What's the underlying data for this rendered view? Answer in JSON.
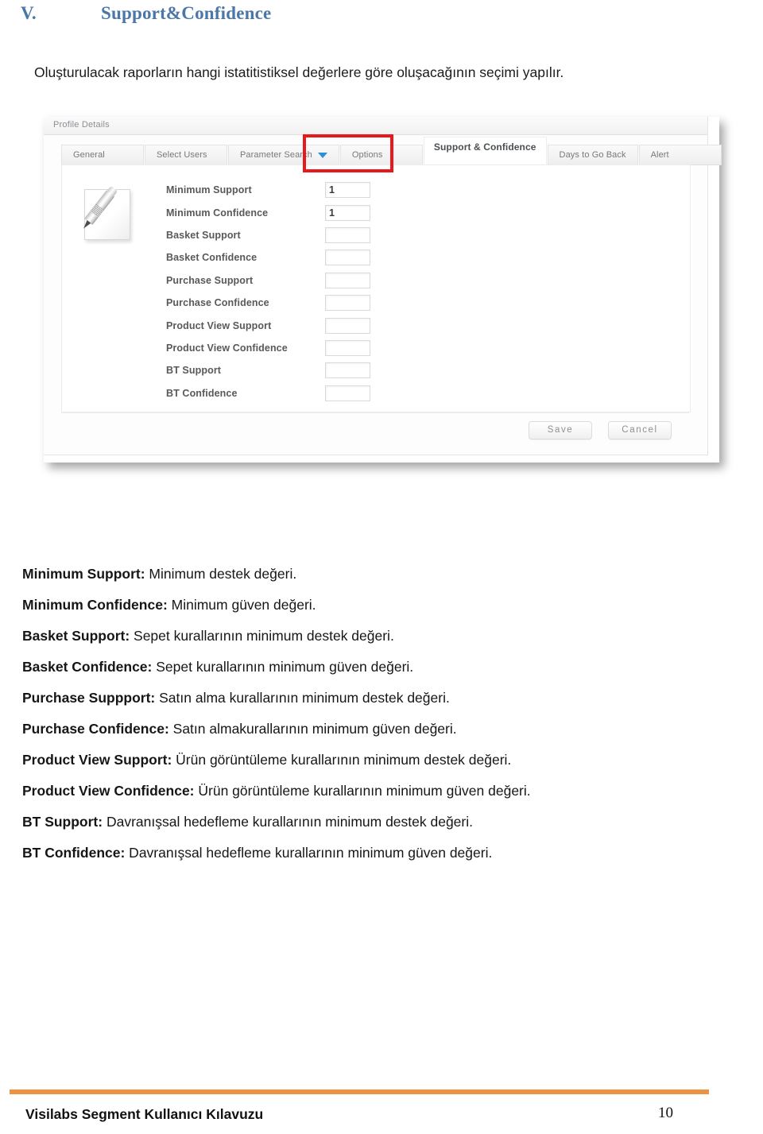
{
  "document": {
    "section_numeral": "V.",
    "section_title": "Support&Confidence",
    "intro": "Oluşturulacak raporların hangi istatitistiksel değerlere göre oluşacağının seçimi yapılır."
  },
  "screenshot": {
    "window_title": "Profile Details",
    "tabs": [
      {
        "label": "General",
        "active": false,
        "has_caret": false
      },
      {
        "label": "Select Users",
        "active": false,
        "has_caret": false
      },
      {
        "label": "Parameter Search",
        "active": false,
        "has_caret": true
      },
      {
        "label": "Options",
        "active": false,
        "has_caret": false
      },
      {
        "label": "Support & Confidence",
        "active": true,
        "has_caret": false
      },
      {
        "label": "Days to Go Back",
        "active": false,
        "has_caret": false
      },
      {
        "label": "Alert",
        "active": false,
        "has_caret": false
      }
    ],
    "highlight_color": "#e8191d",
    "caret_color": "#2d8fd5",
    "fields": [
      {
        "label": "Minimum Support",
        "value": "1"
      },
      {
        "label": "Minimum Confidence",
        "value": "1"
      },
      {
        "label": "Basket Support",
        "value": ""
      },
      {
        "label": "Basket Confidence",
        "value": ""
      },
      {
        "label": "Purchase Support",
        "value": ""
      },
      {
        "label": "Purchase Confidence",
        "value": ""
      },
      {
        "label": "Product View Support",
        "value": ""
      },
      {
        "label": "Product View Confidence",
        "value": ""
      },
      {
        "label": "BT Support",
        "value": ""
      },
      {
        "label": "BT Confidence",
        "value": ""
      }
    ],
    "buttons": {
      "save": "Save",
      "cancel": "Cancel"
    },
    "icon": "document-with-pen-icon"
  },
  "definitions": [
    {
      "term": "Minimum Support:",
      "desc": " Minimum destek değeri."
    },
    {
      "term": "Minimum Confidence:",
      "desc": " Minimum güven değeri."
    },
    {
      "term": "Basket Support:",
      "desc": " Sepet kurallarının minimum destek değeri."
    },
    {
      "term": "Basket Confidence:",
      "desc": " Sepet kurallarının minimum güven değeri."
    },
    {
      "term": "Purchase Suppport:",
      "desc": " Satın alma kurallarının minimum destek değeri."
    },
    {
      "term": "Purchase Confidence:",
      "desc": " Satın almakurallarının minimum güven değeri."
    },
    {
      "term": "Product View Support:",
      "desc": " Ürün görüntüleme kurallarının minimum destek değeri."
    },
    {
      "term": "Product View Confidence:",
      "desc": " Ürün görüntüleme kurallarının minimum güven değeri."
    },
    {
      "term": "BT Support:",
      "desc": " Davranışsal hedefleme kurallarının minimum destek değeri."
    },
    {
      "term": "BT Confidence:",
      "desc": " Davranışsal hedefleme kurallarının minimum güven değeri."
    }
  ],
  "footer": {
    "title": "Visilabs Segment Kullanıcı Kılavuzu",
    "page_number": "10",
    "rule_color": "#ed9143"
  }
}
